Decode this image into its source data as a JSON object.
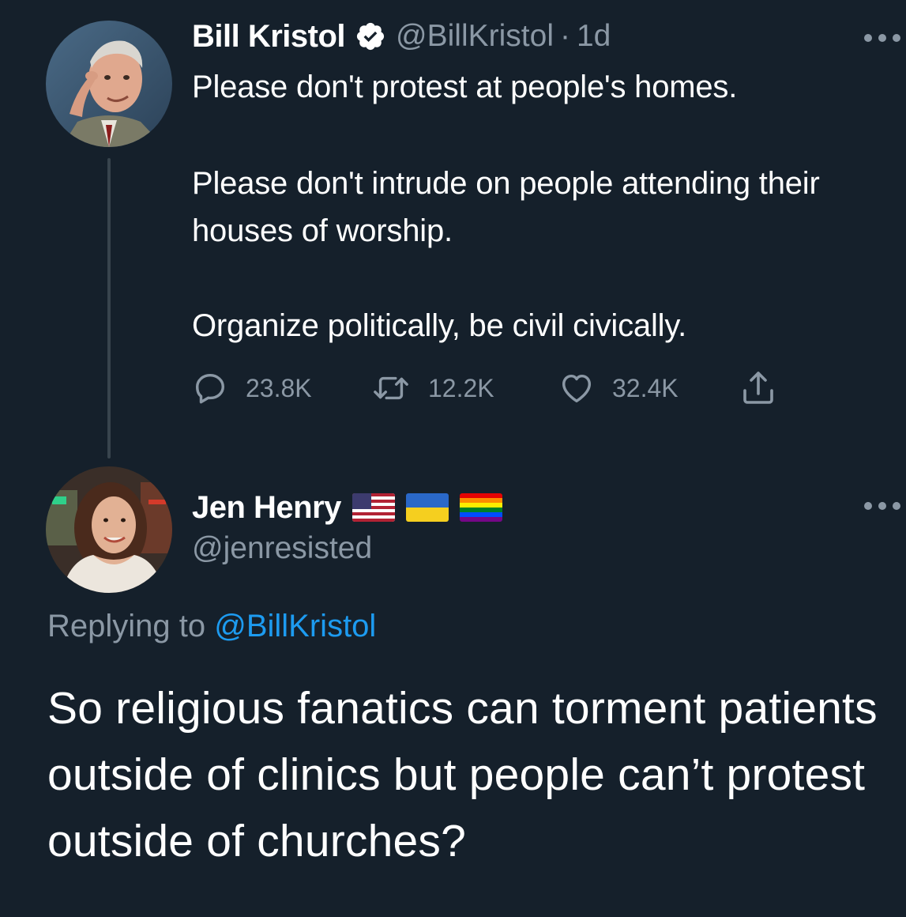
{
  "tweet1": {
    "name": "Bill Kristol",
    "handle": "@BillKristol",
    "separator": "·",
    "time": "1d",
    "paragraphs": [
      "Please don't protest at people's homes.",
      "Please don't intrude on people attending their houses of worship.",
      "Organize politically, be civil civically."
    ],
    "replies": "23.8K",
    "retweets": "12.2K",
    "likes": "32.4K",
    "verified": true
  },
  "tweet2": {
    "name": "Jen Henry",
    "handle": "@jenresisted",
    "flags": [
      "us-flag",
      "ukraine-flag",
      "rainbow-flag"
    ],
    "replying_prefix": "Replying to ",
    "replying_to": "@BillKristol",
    "text": "So religious fanatics can torment patients outside of clinics but people can’t protest outside of churches?"
  },
  "colors": {
    "background": "#15202b",
    "text": "#ffffff",
    "secondary": "#8b98a5",
    "link": "#1d9bf0",
    "thread_line": "#38444d"
  }
}
